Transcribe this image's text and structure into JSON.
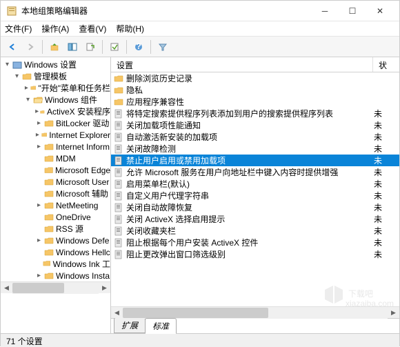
{
  "window": {
    "title": "本地组策略编辑器"
  },
  "menu": {
    "file": "文件(F)",
    "action": "操作(A)",
    "view": "查看(V)",
    "help": "帮助(H)"
  },
  "toolbar": {
    "back": "←",
    "forward": "→"
  },
  "tree": {
    "root": "Windows 设置",
    "admin": "管理模板",
    "start": "\"开始\"菜单和任务栏",
    "wincomp": "Windows 组件",
    "items": [
      "ActiveX 安装程序",
      "BitLocker 驱动",
      "Internet Explorer",
      "Internet Inform",
      "MDM",
      "Microsoft Edge",
      "Microsoft User",
      "Microsoft 辅助",
      "NetMeeting",
      "OneDrive",
      "RSS 源",
      "Windows Defe",
      "Windows Hellc",
      "Windows Ink 工",
      "Windows Insta"
    ]
  },
  "list": {
    "header_setting": "设置",
    "header_state": "状",
    "rows": [
      {
        "text": "删除浏览历史记录",
        "state": ""
      },
      {
        "text": "隐私",
        "state": ""
      },
      {
        "text": "应用程序兼容性",
        "state": ""
      },
      {
        "text": "将特定搜索提供程序列表添加到用户的搜索提供程序列表",
        "state": "未"
      },
      {
        "text": "关闭加载项性能通知",
        "state": "未"
      },
      {
        "text": "自动激活新安装的加载项",
        "state": "未"
      },
      {
        "text": "关闭故障检测",
        "state": "未"
      },
      {
        "text": "禁止用户启用或禁用加载项",
        "state": "未",
        "selected": true
      },
      {
        "text": "允许 Microsoft 服务在用户向地址栏中键入内容时提供增强",
        "state": "未"
      },
      {
        "text": "启用菜单栏(默认)",
        "state": "未"
      },
      {
        "text": "自定义用户代理字符串",
        "state": "未"
      },
      {
        "text": "关闭自动故障恢复",
        "state": "未"
      },
      {
        "text": "关闭 ActiveX 选择启用提示",
        "state": "未"
      },
      {
        "text": "关闭收藏夹栏",
        "state": "未"
      },
      {
        "text": "阻止根据每个用户安装 ActiveX 控件",
        "state": "未"
      },
      {
        "text": "阻止更改弹出窗口筛选级别",
        "state": "未"
      }
    ]
  },
  "tabs": {
    "extended": "扩展",
    "standard": "标准"
  },
  "status": {
    "text": "71 个设置"
  },
  "watermark": {
    "text": "xiazaiba.com",
    "label": "下载吧"
  }
}
